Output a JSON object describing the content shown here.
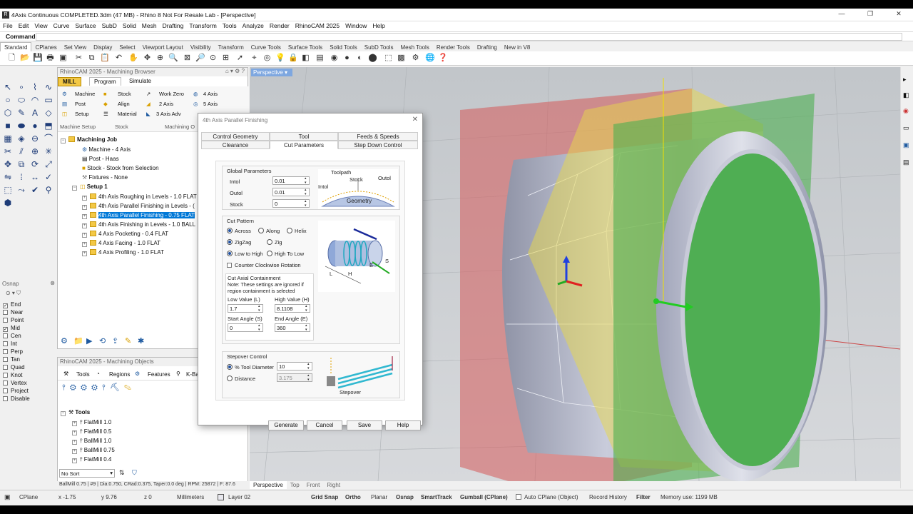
{
  "window": {
    "title": "4Axis Continuous COMPLETED.3dm (47 MB) - Rhino 8 Not For Resale Lab - [Perspective]"
  },
  "menu": [
    "File",
    "Edit",
    "View",
    "Curve",
    "Surface",
    "SubD",
    "Solid",
    "Mesh",
    "Drafting",
    "Transform",
    "Tools",
    "Analyze",
    "Render",
    "RhinoCAM 2025",
    "Window",
    "Help"
  ],
  "command": {
    "label": "Command:"
  },
  "toolbar_tabs": [
    "Standard",
    "CPlanes",
    "Set View",
    "Display",
    "Select",
    "Viewport Layout",
    "Visibility",
    "Transform",
    "Curve Tools",
    "Surface Tools",
    "Solid Tools",
    "SubD Tools",
    "Mesh Tools",
    "Render Tools",
    "Drafting",
    "New in V8"
  ],
  "machining_browser": {
    "title": "RhinoCAM 2025 - Machining Browser",
    "mill": "MILL",
    "tabs": [
      "Program",
      "Simulate"
    ],
    "ribbon": {
      "machine": "Machine",
      "post": "Post",
      "setup": "Setup",
      "stock": "Stock",
      "align": "Align",
      "material": "Material",
      "work_zero": "Work Zero",
      "two_axis": "2 Axis",
      "three_axis_adv": "3 Axis Adv",
      "four_axis": "4 Axis",
      "five_axis": "5 Axis",
      "group_machine_setup": "Machine Setup",
      "group_stock": "Stock",
      "group_machining_ops": "Machining O"
    },
    "tree": {
      "job": "Machining Job",
      "machine": "Machine - 4 Axis",
      "post": "Post - Haas",
      "stock": "Stock - Stock from Selection",
      "fixtures": "Fixtures - None",
      "setup": "Setup 1",
      "ops": [
        "4th Axis Roughing in Levels - 1.0 FLAT",
        "4th Axis Parallel Finishing in Levels - (",
        "4th Axis Parallel Finishing - 0.75 FLAT",
        "4th Axis Finishing in Levels - 1.0 BALL",
        "4 Axis Pocketing - 0.4 FLAT",
        "4 Axis Facing - 1.0 FLAT",
        "4 Axis Profiling - 1.0 FLAT"
      ]
    }
  },
  "osnap": {
    "title": "Osnap",
    "items": [
      {
        "label": "End",
        "checked": true
      },
      {
        "label": "Near",
        "checked": false
      },
      {
        "label": "Point",
        "checked": false
      },
      {
        "label": "Mid",
        "checked": true
      },
      {
        "label": "Cen",
        "checked": false
      },
      {
        "label": "Int",
        "checked": false
      },
      {
        "label": "Perp",
        "checked": false
      },
      {
        "label": "Tan",
        "checked": false
      },
      {
        "label": "Quad",
        "checked": false
      },
      {
        "label": "Knot",
        "checked": false
      },
      {
        "label": "Vertex",
        "checked": false
      },
      {
        "label": "Project",
        "checked": false
      },
      {
        "label": "Disable",
        "checked": false
      }
    ]
  },
  "machining_objects": {
    "title": "RhinoCAM 2025 - Machining Objects",
    "tabs": [
      "Tools",
      "Regions",
      "Features",
      "K-Ba"
    ],
    "tree_root": "Tools",
    "tools": [
      "FlatMill 1.0",
      "FlatMill 0.5",
      "BallMill 1.0",
      "BallMill 0.75",
      "FlatMill 0.4"
    ],
    "sort": "No Sort"
  },
  "status_tool": "BallMill 0.75 | #9 | Dia:0.750, CRad:0.375, Taper:0.0 deg | RPM: 25872 | F: 87.6",
  "viewport": {
    "name": "Perspective"
  },
  "view_tabs": [
    "Perspective",
    "Top",
    "Front",
    "Right"
  ],
  "statusbar": {
    "cplane": "CPlane",
    "x": "x -1.75",
    "y": "y 9.76",
    "z": "z 0",
    "units": "Millimeters",
    "layer": "Layer 02",
    "grid_snap": "Grid Snap",
    "ortho": "Ortho",
    "planar": "Planar",
    "osnap": "Osnap",
    "smarttrack": "SmartTrack",
    "gumball": "Gumball (CPlane)",
    "auto_cplane": "Auto CPlane (Object)",
    "record_history": "Record History",
    "filter": "Filter",
    "memory": "Memory use: 1199 MB"
  },
  "dialog": {
    "title": "4th Axis Parallel Finishing",
    "tabs_row1": [
      "Control Geometry",
      "Tool",
      "Feeds & Speeds"
    ],
    "tabs_row2": [
      "Clearance",
      "Cut Parameters",
      "Step Down Control"
    ],
    "global": {
      "label": "Global Parameters",
      "intol_label": "Intol",
      "intol": "0.01",
      "outol_label": "Outol",
      "outol": "0.01",
      "stock_label": "Stock",
      "stock": "0",
      "fig_toolpath": "Toolpath",
      "fig_stock": "Stock",
      "fig_outol": "Outol",
      "fig_intol": "Intol",
      "fig_geometry": "Geometry"
    },
    "cut_pattern": {
      "label": "Cut Pattern",
      "across": "Across",
      "along": "Along",
      "helix": "Helix",
      "zigzag": "ZigZag",
      "zig": "Zig",
      "low_to_high": "Low to High",
      "high_to_low": "High To Low",
      "ccw": "Counter Clockwise Rotation",
      "fig_l": "L",
      "fig_h": "H",
      "fig_e": "E",
      "fig_s": "S"
    },
    "axial": {
      "label": "Cut Axial Containment",
      "note": "Note:  These settings are ignored if region containment is selected",
      "low_label": "Low Value (L)",
      "low": "1.7",
      "high_label": "High Value (H)",
      "high": "8.1108",
      "start_label": "Start Angle (S)",
      "start": "0",
      "end_label": "End Angle (E)",
      "end": "360"
    },
    "stepover": {
      "label": "Stepover Control",
      "pct_label": "% Tool Diameter",
      "pct": "10",
      "dist_label": "Distance",
      "dist": "3.175",
      "fig_label": "Stepover"
    },
    "buttons": {
      "generate": "Generate",
      "cancel": "Cancel",
      "save": "Save",
      "help": "Help"
    }
  }
}
